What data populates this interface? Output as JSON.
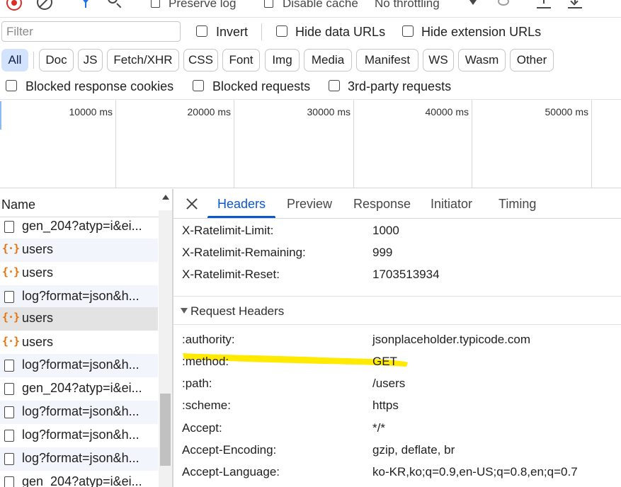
{
  "toolbar": {
    "preserve_log_label": "Preserve log",
    "disable_cache_label": "Disable cache",
    "throttling_value": "No throttling"
  },
  "filter_bar": {
    "filter_placeholder": "Filter",
    "invert_label": "Invert",
    "hide_data_urls_label": "Hide data URLs",
    "hide_extension_urls_label": "Hide extension URLs"
  },
  "type_filters": [
    "All",
    "Doc",
    "JS",
    "Fetch/XHR",
    "CSS",
    "Font",
    "Img",
    "Media",
    "Manifest",
    "WS",
    "Wasm",
    "Other"
  ],
  "active_type_filter": "All",
  "options_row": {
    "blocked_cookies_label": "Blocked response cookies",
    "blocked_requests_label": "Blocked requests",
    "third_party_label": "3rd-party requests"
  },
  "timeline": {
    "ticks": [
      "10000 ms",
      "20000 ms",
      "30000 ms",
      "40000 ms",
      "50000 ms"
    ]
  },
  "request_list": {
    "header": "Name",
    "rows": [
      {
        "name": "gen_204?atyp=i&ei...",
        "type": "doc"
      },
      {
        "name": "users",
        "type": "xhr"
      },
      {
        "name": "users",
        "type": "xhr"
      },
      {
        "name": "log?format=json&h...",
        "type": "doc"
      },
      {
        "name": "users",
        "type": "xhr"
      },
      {
        "name": "users",
        "type": "xhr"
      },
      {
        "name": "log?format=json&h...",
        "type": "doc"
      },
      {
        "name": "gen_204?atyp=i&ei...",
        "type": "doc"
      },
      {
        "name": "log?format=json&h...",
        "type": "doc"
      },
      {
        "name": "log?format=json&h...",
        "type": "doc"
      },
      {
        "name": "log?format=json&h...",
        "type": "doc"
      },
      {
        "name": "gen_204?atyp=i&ei...",
        "type": "doc"
      }
    ],
    "selected_index": 4
  },
  "detail": {
    "tabs": [
      "Headers",
      "Preview",
      "Response",
      "Initiator",
      "Timing"
    ],
    "active_tab": "Headers",
    "response_headers_tail": [
      {
        "name": "X-Ratelimit-Limit:",
        "value": "1000"
      },
      {
        "name": "X-Ratelimit-Remaining:",
        "value": "999"
      },
      {
        "name": "X-Ratelimit-Reset:",
        "value": "1703513934"
      }
    ],
    "request_headers_title": "Request Headers",
    "request_headers": [
      {
        "name": ":authority:",
        "value": "jsonplaceholder.typicode.com"
      },
      {
        "name": ":method:",
        "value": "GET"
      },
      {
        "name": ":path:",
        "value": "/users"
      },
      {
        "name": ":scheme:",
        "value": "https"
      },
      {
        "name": "Accept:",
        "value": "*/*"
      },
      {
        "name": "Accept-Encoding:",
        "value": "gzip, deflate, br"
      },
      {
        "name": "Accept-Language:",
        "value": "ko-KR,ko;q=0.9,en-US;q=0.8,en;q=0.7"
      }
    ],
    "highlight_color": "#ffea00"
  },
  "colors": {
    "accent": "#0b57d0",
    "record": "#d93025",
    "xhr_icon": "#e8710a",
    "pill_active_bg": "#d3e3fd"
  }
}
